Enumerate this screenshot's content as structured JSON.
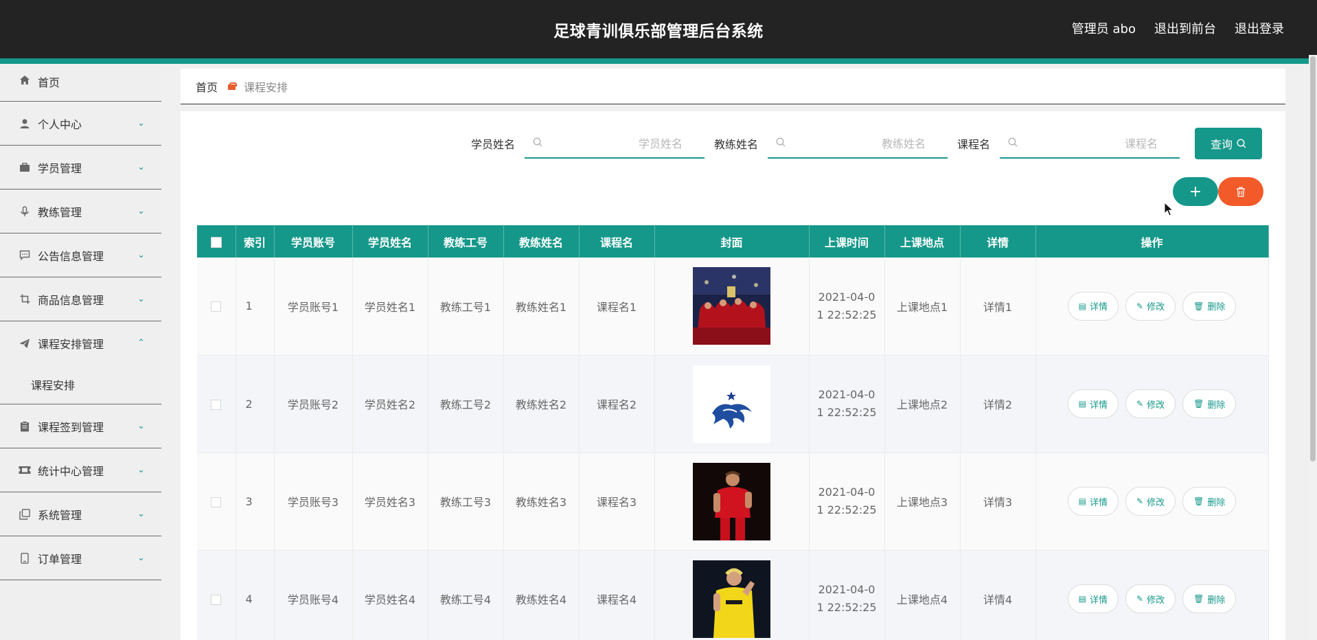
{
  "header": {
    "title": "足球青训俱乐部管理后台系统",
    "admin": "管理员 abo",
    "front": "退出到前台",
    "logout": "退出登录"
  },
  "sidebar": {
    "items": [
      {
        "label": "首页",
        "icon": "home-icon"
      },
      {
        "label": "个人中心",
        "icon": "user-icon"
      },
      {
        "label": "学员管理",
        "icon": "briefcase-icon"
      },
      {
        "label": "教练管理",
        "icon": "microphone-icon"
      },
      {
        "label": "公告信息管理",
        "icon": "message-icon"
      },
      {
        "label": "商品信息管理",
        "icon": "crop-icon"
      },
      {
        "label": "课程安排管理",
        "icon": "paper-plane-icon"
      },
      {
        "label": "课程签到管理",
        "icon": "clipboard-icon"
      },
      {
        "label": "统计中心管理",
        "icon": "ticket-icon"
      },
      {
        "label": "系统管理",
        "icon": "copy-icon"
      },
      {
        "label": "订单管理",
        "icon": "phone-icon"
      }
    ],
    "submenu": "课程安排"
  },
  "breadcrumb": {
    "home": "首页",
    "current": "课程安排"
  },
  "search": {
    "student_label": "学员姓名",
    "student_placeholder": "学员姓名",
    "coach_label": "教练姓名",
    "coach_placeholder": "教练姓名",
    "course_label": "课程名",
    "course_placeholder": "课程名",
    "query": "查询"
  },
  "toolbar": {
    "add": "+",
    "delete_icon": "trash-icon"
  },
  "table": {
    "columns": [
      "索引",
      "学员账号",
      "学员姓名",
      "教练工号",
      "教练姓名",
      "课程名",
      "封面",
      "上课时间",
      "上课地点",
      "详情",
      "操作"
    ],
    "rows": [
      {
        "idx": "1",
        "account": "学员账号1",
        "name": "学员姓名1",
        "coach_id": "教练工号1",
        "coach": "教练姓名1",
        "course": "课程名1",
        "time": "2021-04-01 22:52:25",
        "place": "上课地点1",
        "detail": "详情1"
      },
      {
        "idx": "2",
        "account": "学员账号2",
        "name": "学员姓名2",
        "coach_id": "教练工号2",
        "coach": "教练姓名2",
        "course": "课程名2",
        "time": "2021-04-01 22:52:25",
        "place": "上课地点2",
        "detail": "详情2"
      },
      {
        "idx": "3",
        "account": "学员账号3",
        "name": "学员姓名3",
        "coach_id": "教练工号3",
        "coach": "教练姓名3",
        "course": "课程名3",
        "time": "2021-04-01 22:52:25",
        "place": "上课地点3",
        "detail": "详情3"
      },
      {
        "idx": "4",
        "account": "学员账号4",
        "name": "学员姓名4",
        "coach_id": "教练工号4",
        "coach": "教练姓名4",
        "course": "课程名4",
        "time": "2021-04-01 22:52:25",
        "place": "上课地点4",
        "detail": "详情4"
      }
    ],
    "actions": {
      "detail": "详情",
      "edit": "修改",
      "delete": "删除"
    }
  },
  "colors": {
    "accent": "#15988a",
    "danger": "#f35a2a",
    "header_bg": "#232323"
  }
}
